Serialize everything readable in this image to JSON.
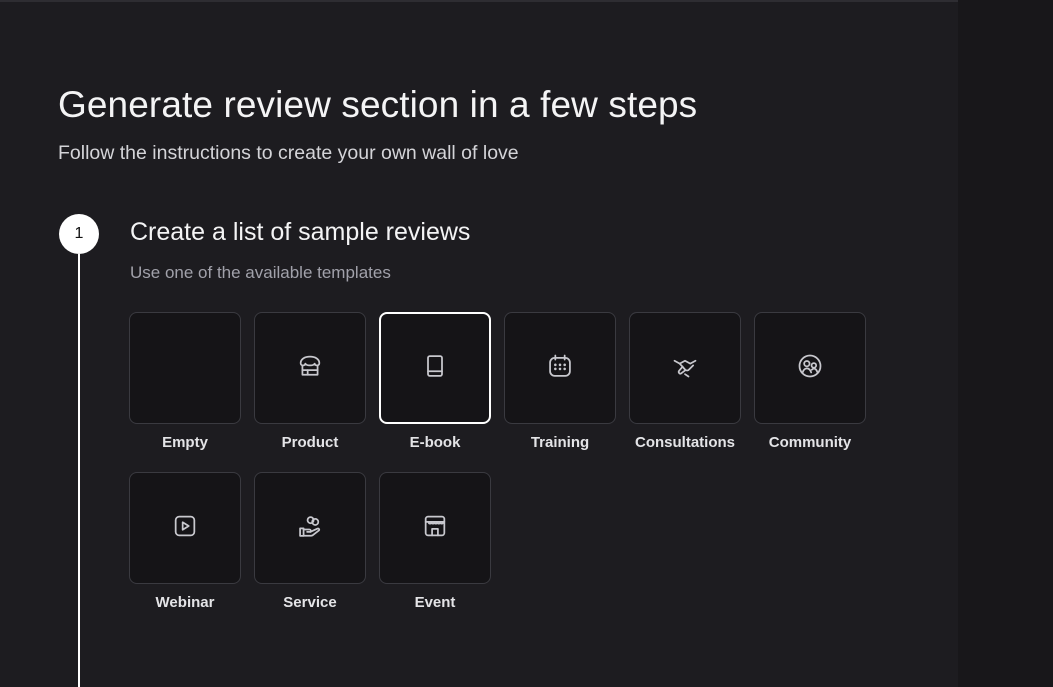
{
  "header": {
    "title": "Generate review section in a few steps",
    "subtitle": "Follow the instructions to create your own wall of love"
  },
  "step": {
    "number": "1",
    "title": "Create a list of sample reviews",
    "description": "Use one of the available templates"
  },
  "templates": [
    {
      "label": "Empty",
      "icon": "none",
      "selected": false
    },
    {
      "label": "Product",
      "icon": "store-icon",
      "selected": false
    },
    {
      "label": "E-book",
      "icon": "book-icon",
      "selected": true
    },
    {
      "label": "Training",
      "icon": "calendar-icon",
      "selected": false
    },
    {
      "label": "Consultations",
      "icon": "handshake-icon",
      "selected": false
    },
    {
      "label": "Community",
      "icon": "users-round-icon",
      "selected": false
    },
    {
      "label": "Webinar",
      "icon": "play-square-icon",
      "selected": false
    },
    {
      "label": "Service",
      "icon": "hand-coins-icon",
      "selected": false
    },
    {
      "label": "Event",
      "icon": "venue-icon",
      "selected": false
    }
  ],
  "colors": {
    "background": "#1d1c20",
    "card": "#151417",
    "card_border": "#3a3a40",
    "selected_border": "#ffffff",
    "accent": "#ffffff"
  }
}
